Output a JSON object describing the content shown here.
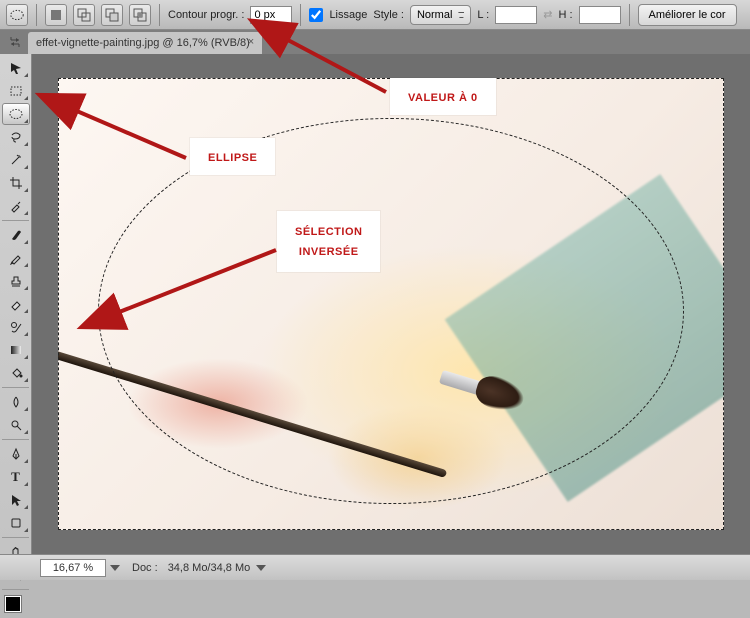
{
  "options_bar": {
    "contour_label": "Contour progr. :",
    "contour_value": "0 px",
    "lissage_label": "Lissage",
    "lissage_checked": true,
    "style_label": "Style :",
    "style_value": "Normal",
    "width_label": "L :",
    "width_value": "",
    "height_label": "H :",
    "height_value": "",
    "refine_button": "Améliorer le cor"
  },
  "tab": {
    "filename": "effet-vignette-painting.jpg",
    "info": "@ 16,7% (RVB/8)"
  },
  "toolbox": {
    "active_tool": "ellipse-marquee"
  },
  "annotations": {
    "valeur": "VALEUR À 0",
    "ellipse": "ELLIPSE",
    "selection_line1": "SÉLECTION",
    "selection_line2": "INVERSÉE"
  },
  "statusbar": {
    "zoom": "16,67 %",
    "doc_label": "Doc :",
    "doc_size": "34,8 Mo/34,8 Mo"
  },
  "colors": {
    "annotation_red": "#c01818",
    "arrow_red": "#b01717"
  }
}
